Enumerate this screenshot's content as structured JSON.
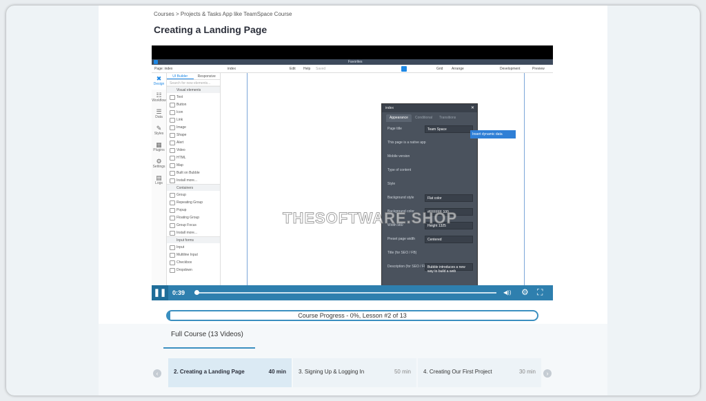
{
  "breadcrumb": "Courses > Projects & Tasks App like TeamSpace Course",
  "title": "Creating a Landing Page",
  "video": {
    "app": {
      "topbar": "Favorites",
      "toolbar": {
        "page": "Page: index",
        "index": "index",
        "edit": "Edit",
        "help": "Help",
        "saved": "Saved",
        "grid": "Grid",
        "arrange": "Arrange",
        "development": "Development",
        "preview": "Preview"
      },
      "sidebar": [
        {
          "label": "Design",
          "icon": "✖"
        },
        {
          "label": "Workflow",
          "icon": "☷"
        },
        {
          "label": "Data",
          "icon": "☰"
        },
        {
          "label": "Styles",
          "icon": "✎"
        },
        {
          "label": "Plugins",
          "icon": "▦"
        },
        {
          "label": "Settings",
          "icon": "⚙"
        },
        {
          "label": "Logs",
          "icon": "▤"
        }
      ],
      "elements": {
        "tab_ui": "UI Builder",
        "tab_responsive": "Responsive",
        "search": "Search for new elements...",
        "visual_header": "Visual elements",
        "visual": [
          "Text",
          "Button",
          "Icon",
          "Link",
          "Image",
          "Shape",
          "Alert",
          "Video",
          "HTML",
          "Map",
          "Built on Bubble",
          "Install more..."
        ],
        "containers_header": "Containers",
        "containers": [
          "Group",
          "Repeating Group",
          "Popup",
          "Floating Group",
          "Group Focus",
          "Install more..."
        ],
        "inputs_header": "Input forms",
        "inputs": [
          "Input",
          "Multiline Input",
          "Checkbox",
          "Dropdown"
        ]
      },
      "panel": {
        "title": "index",
        "tabs": [
          "Appearance",
          "Conditional",
          "Transitions"
        ],
        "rows": [
          {
            "label": "Page title",
            "value": "Team Space"
          },
          {
            "label": "This page is a native app",
            "value": ""
          },
          {
            "label": "Mobile version",
            "value": ""
          },
          {
            "label": "Type of content",
            "value": ""
          },
          {
            "label": "Style",
            "value": ""
          },
          {
            "label": "Background style",
            "value": "Flat color"
          },
          {
            "label": "Background color",
            "value": "#FFFFFF   100"
          },
          {
            "label": "Width  980",
            "value": "Height  1325"
          },
          {
            "label": "Preset page width",
            "value": "Centered"
          },
          {
            "label": "Title (for SEO / FB)",
            "value": ""
          },
          {
            "label": "Description (for SEO / FB)",
            "value": "Bubble introduces a new way to build a web"
          }
        ]
      },
      "dynamic_data": "Insert dynamic data"
    },
    "watermark": "THESOFTWARE.SHOP",
    "time": "0:39",
    "play_icon": "❚❚",
    "volume_icon": "◀))",
    "settings_icon": "⚙",
    "fullscreen_icon": "⛶"
  },
  "progress": {
    "text": "Course Progress - 0%, Lesson #2 of 13",
    "percent": 0
  },
  "full_course": "Full Course  (13 Videos)",
  "lessons": [
    {
      "title": "2. Creating a Landing Page",
      "minutes": "40 min"
    },
    {
      "title": "3. Signing Up & Logging In",
      "minutes": "50 min"
    },
    {
      "title": "4. Creating Our First Project",
      "minutes": "30 min"
    }
  ],
  "nav": {
    "prev": "‹",
    "next": "›"
  }
}
